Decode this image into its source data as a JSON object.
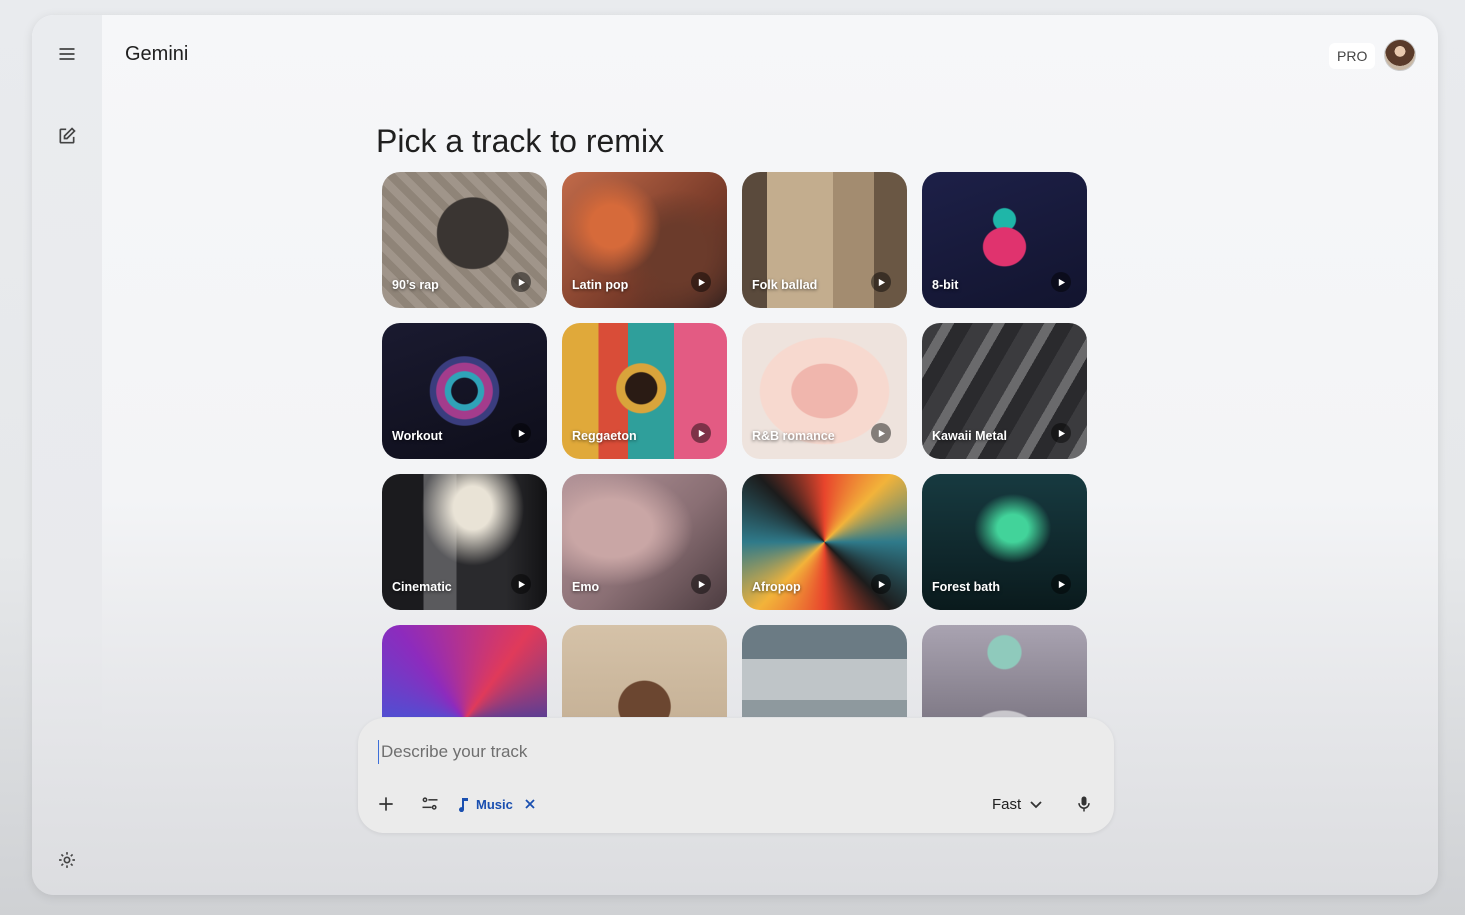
{
  "app": {
    "title": "Gemini",
    "plan_badge": "PRO"
  },
  "rail": {
    "menu_icon": "menu-icon",
    "new_chat_icon": "edit-icon",
    "settings_icon": "gear-icon"
  },
  "main": {
    "heading": "Pick a track to remix",
    "tracks": [
      {
        "label": "90’s rap"
      },
      {
        "label": "Latin pop"
      },
      {
        "label": "Folk ballad"
      },
      {
        "label": "8-bit"
      },
      {
        "label": "Workout"
      },
      {
        "label": "Reggaeton"
      },
      {
        "label": "R&B romance"
      },
      {
        "label": "Kawaii Metal"
      },
      {
        "label": "Cinematic"
      },
      {
        "label": "Emo"
      },
      {
        "label": "Afropop"
      },
      {
        "label": "Forest bath"
      },
      {
        "label": ""
      },
      {
        "label": ""
      },
      {
        "label": ""
      },
      {
        "label": ""
      }
    ]
  },
  "composer": {
    "placeholder": "Describe your track",
    "tool_chip": {
      "label": "Music",
      "icon": "music-note-icon"
    },
    "model": {
      "label": "Fast",
      "icon": "chevron-down-icon"
    },
    "icons": {
      "add": "plus-icon",
      "tools": "tune-icon",
      "remove_chip": "close-icon",
      "mic": "mic-icon"
    }
  },
  "colors": {
    "accent": "#1a4fb0",
    "caret": "#3d6fd9"
  }
}
